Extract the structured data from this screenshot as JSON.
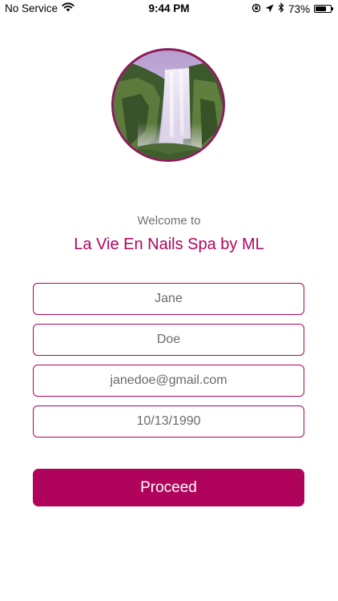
{
  "status_bar": {
    "carrier": "No Service",
    "time": "9:44 PM",
    "battery_percent": "73%",
    "battery_level": 0.73,
    "icons": [
      "wifi-icon",
      "rotation-lock-icon",
      "location-arrow-icon",
      "bluetooth-icon",
      "battery-icon"
    ]
  },
  "welcome": {
    "intro": "Welcome to",
    "spa_name": "La Vie En Nails Spa by ML"
  },
  "form": {
    "first_name": "Jane",
    "last_name": "Doe",
    "email": "janedoe@gmail.com",
    "date_of_birth": "10/13/1990"
  },
  "actions": {
    "proceed_label": "Proceed"
  },
  "colors": {
    "accent": "#b0045c",
    "text_muted": "#6a6a6a",
    "background": "#ffffff"
  }
}
